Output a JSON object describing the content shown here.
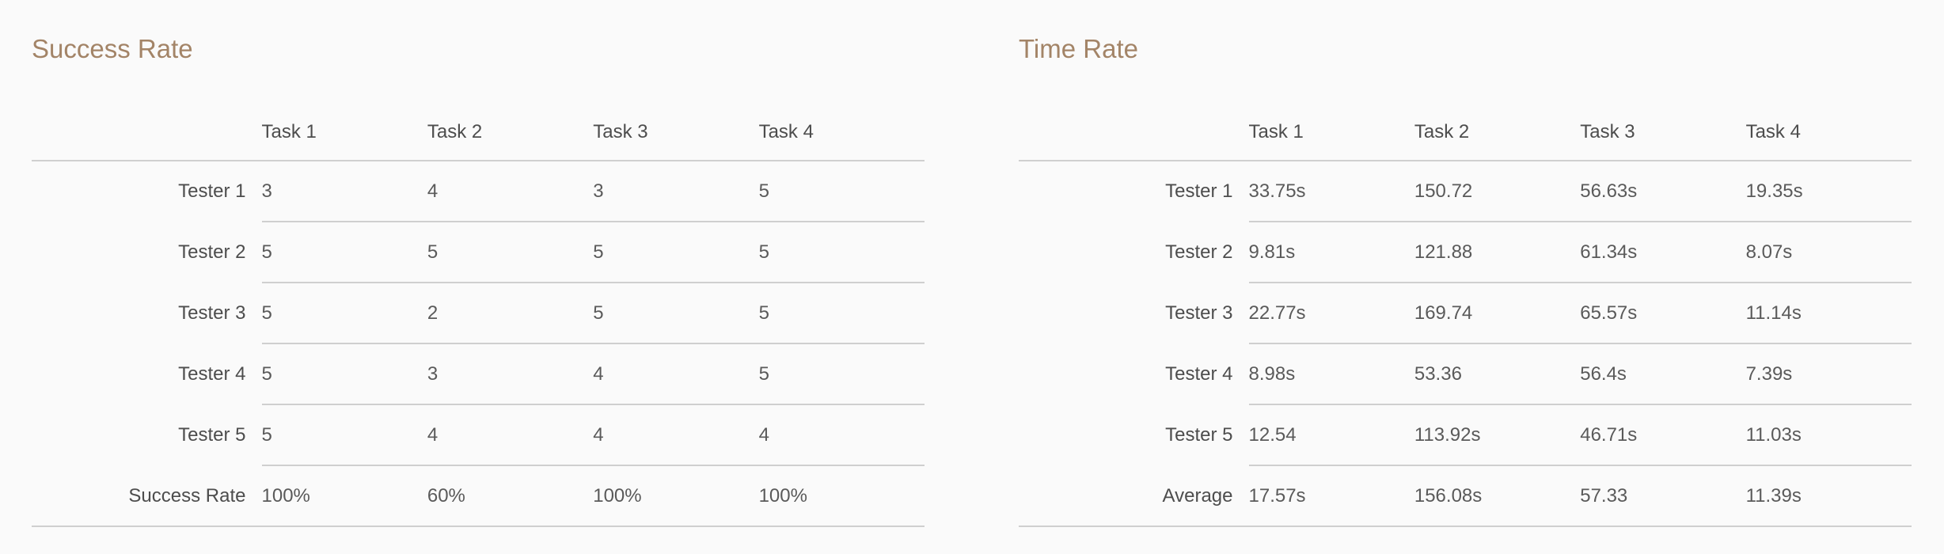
{
  "success_rate": {
    "title": "Success Rate",
    "columns": [
      "Task 1",
      "Task 2",
      "Task 3",
      "Task 4"
    ],
    "rows": [
      {
        "label": "Tester 1",
        "values": [
          "3",
          "4",
          "3",
          "5"
        ]
      },
      {
        "label": "Tester 2",
        "values": [
          "5",
          "5",
          "5",
          "5"
        ]
      },
      {
        "label": "Tester 3",
        "values": [
          "5",
          "2",
          "5",
          "5"
        ]
      },
      {
        "label": "Tester 4",
        "values": [
          "5",
          "3",
          "4",
          "5"
        ]
      },
      {
        "label": "Tester 5",
        "values": [
          "5",
          "4",
          "4",
          "4"
        ]
      },
      {
        "label": "Success Rate",
        "values": [
          "100%",
          "60%",
          "100%",
          "100%"
        ]
      }
    ]
  },
  "time_rate": {
    "title": "Time Rate",
    "columns": [
      "Task 1",
      "Task 2",
      "Task 3",
      "Task 4"
    ],
    "rows": [
      {
        "label": "Tester 1",
        "values": [
          "33.75s",
          "150.72",
          "56.63s",
          "19.35s"
        ]
      },
      {
        "label": "Tester 2",
        "values": [
          "9.81s",
          "121.88",
          "61.34s",
          "8.07s"
        ]
      },
      {
        "label": "Tester 3",
        "values": [
          "22.77s",
          "169.74",
          "65.57s",
          "11.14s"
        ]
      },
      {
        "label": "Tester 4",
        "values": [
          "8.98s",
          "53.36",
          "56.4s",
          "7.39s"
        ]
      },
      {
        "label": "Tester 5",
        "values": [
          "12.54",
          "113.92s",
          "46.71s",
          "11.03s"
        ]
      },
      {
        "label": "Average",
        "values": [
          "17.57s",
          "156.08s",
          "57.33",
          "11.39s"
        ]
      }
    ]
  },
  "colors": {
    "title_accent": "#a38467",
    "text": "#4d4d4d",
    "divider": "#cfcfcf",
    "background": "#fafafa"
  }
}
